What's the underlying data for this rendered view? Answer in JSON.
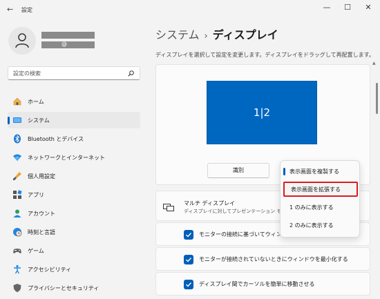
{
  "window": {
    "title": "設定",
    "back_glyph": "←",
    "minimize_glyph": "—",
    "maximize_glyph": "☐",
    "close_glyph": "✕"
  },
  "profile": {
    "email_fragment": "@"
  },
  "search": {
    "placeholder": "設定の検索"
  },
  "sidebar": {
    "items": [
      {
        "label": "ホーム",
        "icon": "home-icon"
      },
      {
        "label": "システム",
        "icon": "system-icon",
        "selected": true
      },
      {
        "label": "Bluetooth とデバイス",
        "icon": "bluetooth-icon"
      },
      {
        "label": "ネットワークとインターネット",
        "icon": "wifi-icon"
      },
      {
        "label": "個人用設定",
        "icon": "brush-icon"
      },
      {
        "label": "アプリ",
        "icon": "apps-icon"
      },
      {
        "label": "アカウント",
        "icon": "account-icon"
      },
      {
        "label": "時刻と言語",
        "icon": "clock-globe-icon"
      },
      {
        "label": "ゲーム",
        "icon": "game-icon"
      },
      {
        "label": "アクセシビリティ",
        "icon": "accessibility-icon"
      },
      {
        "label": "プライバシーとセキュリティ",
        "icon": "shield-icon"
      }
    ]
  },
  "main": {
    "breadcrumb": {
      "parent": "システム",
      "separator": "›",
      "current": "ディスプレイ"
    },
    "instruction": "ディスプレイを選択して設定を変更します。ディスプレイをドラッグして再配置します。",
    "monitor_label": "1|2",
    "identify_label": "識別",
    "multi_display": {
      "title": "マルチ ディスプレイ",
      "subtitle": "ディスプレイに対してプレゼンテーション モードを"
    },
    "checkboxes": [
      {
        "label": "モニターの接続に基づいてウィンドウの",
        "checked": true
      },
      {
        "label": "モニターが接続されていないときにウィンドウを最小化する",
        "checked": true
      },
      {
        "label": "ディスプレイ間でカーソルを簡単に移動させる",
        "checked": true
      }
    ]
  },
  "dropdown": {
    "options": [
      {
        "label": "表示画面を複製する",
        "current": true
      },
      {
        "label": "表示画面を拡張する",
        "highlighted": true
      },
      {
        "label": "1 のみに表示する"
      },
      {
        "label": "2 のみに表示する"
      }
    ]
  },
  "colors": {
    "accent": "#005fb8",
    "monitor": "#0067c0",
    "highlight_border": "#d91c1c"
  }
}
